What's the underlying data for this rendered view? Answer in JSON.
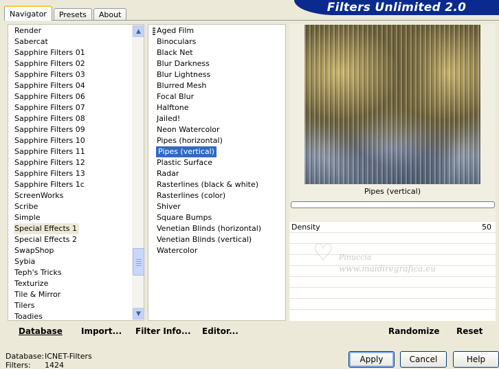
{
  "tabs": [
    "Navigator",
    "Presets",
    "About"
  ],
  "banner": "Filters Unlimited 2.0",
  "categories": [
    "Render",
    "Sabercat",
    "Sapphire Filters 01",
    "Sapphire Filters 02",
    "Sapphire Filters 03",
    "Sapphire Filters 04",
    "Sapphire Filters 06",
    "Sapphire Filters 07",
    "Sapphire Filters 08",
    "Sapphire Filters 09",
    "Sapphire Filters 10",
    "Sapphire Filters 11",
    "Sapphire Filters 12",
    "Sapphire Filters 13",
    "Sapphire Filters 1c",
    "ScreenWorks",
    "Scribe",
    "Simple",
    "Special Effects 1",
    "Special Effects 2",
    "SwapShop",
    "Sybia",
    "Teph's Tricks",
    "Texturize",
    "Tile & Mirror",
    "Tilers",
    "Toadies"
  ],
  "selected_category": "Special Effects 1",
  "filters": [
    "Aged Film",
    "Binoculars",
    "Black Net",
    "Blur Darkness",
    "Blur Lightness",
    "Blurred Mesh",
    "Focal Blur",
    "Halftone",
    "Jailed!",
    "Neon Watercolor",
    "Pipes (horizontal)",
    "Pipes (vertical)",
    "Plastic Surface",
    "Radar",
    "Rasterlines (black & white)",
    "Rasterlines (color)",
    "Shiver",
    "Square Bumps",
    "Venetian Blinds (horizontal)",
    "Venetian Blinds (vertical)",
    "Watercolor"
  ],
  "selected_filter": "Pipes (vertical)",
  "preview_title": "Pipes (vertical)",
  "param": {
    "label": "Density",
    "value": "50"
  },
  "watermark": {
    "line1": "Pinuccia",
    "line2": "www.maidiregrafica.eu"
  },
  "toolbar": {
    "database": "Database",
    "import": "Import...",
    "filter_info": "Filter Info...",
    "editor": "Editor...",
    "randomize": "Randomize",
    "reset": "Reset"
  },
  "footer": {
    "database_label": "Database:",
    "database_value": "ICNET-Filters",
    "filters_label": "Filters:",
    "filters_value": "1424"
  },
  "buttons": {
    "apply": "Apply",
    "cancel": "Cancel",
    "help": "Help"
  }
}
